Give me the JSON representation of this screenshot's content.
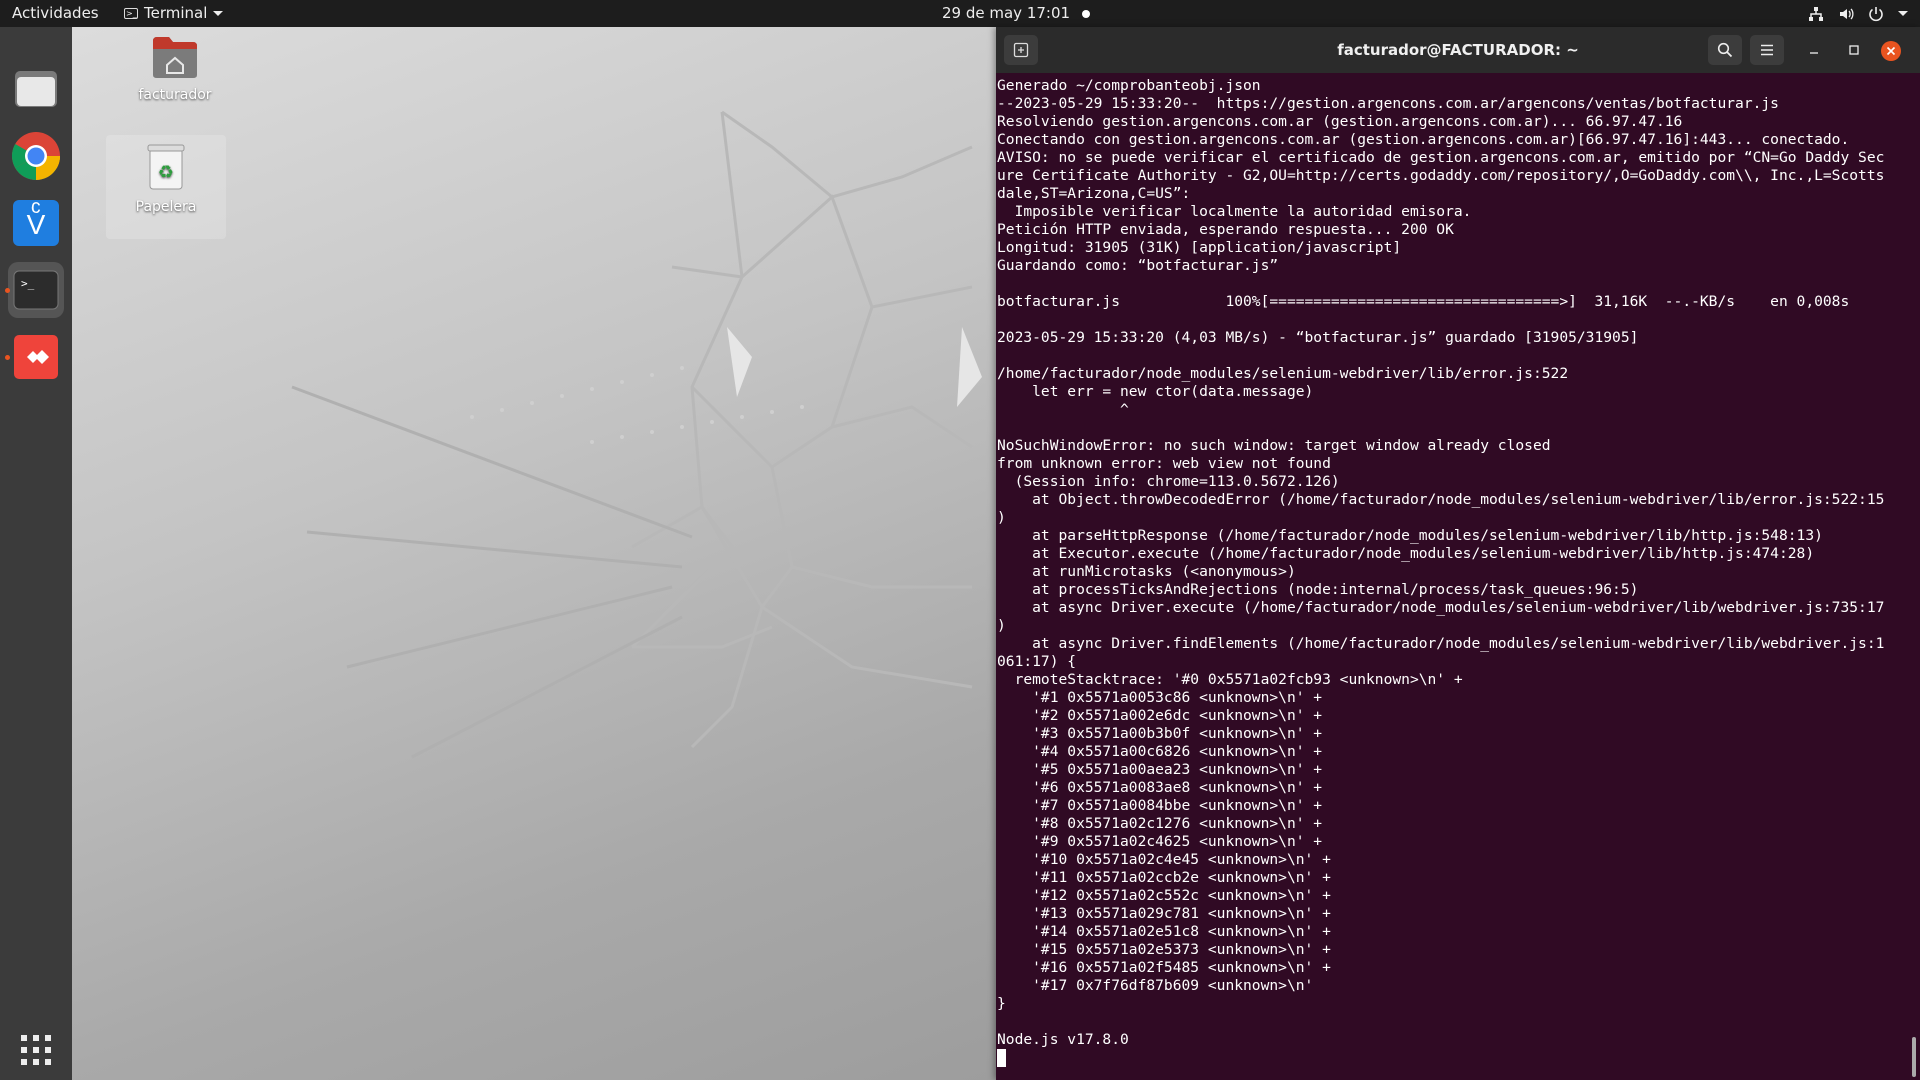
{
  "topbar": {
    "activities": "Actividades",
    "app_name": "Terminal",
    "clock": "29 de may  17:01"
  },
  "dock": {
    "apps": [
      "files",
      "chrome",
      "vscode",
      "terminal",
      "anydesk"
    ]
  },
  "desktop": {
    "icons": [
      {
        "label": "facturador"
      },
      {
        "label": "Papelera"
      }
    ]
  },
  "terminal": {
    "title": "facturador@FACTURADOR: ~",
    "colors": {
      "background": "#300a24",
      "accent": "#e95420"
    },
    "lines": [
      "Generado ~/comprobanteobj.json",
      "--2023-05-29 15:33:20--  https://gestion.argencons.com.ar/argencons/ventas/botfacturar.js",
      "Resolviendo gestion.argencons.com.ar (gestion.argencons.com.ar)... 66.97.47.16",
      "Conectando con gestion.argencons.com.ar (gestion.argencons.com.ar)[66.97.47.16]:443... conectado.",
      "AVISO: no se puede verificar el certificado de gestion.argencons.com.ar, emitido por “CN=Go Daddy Sec",
      "ure Certificate Authority - G2,OU=http://certs.godaddy.com/repository/,O=GoDaddy.com\\\\, Inc.,L=Scotts",
      "dale,ST=Arizona,C=US”:",
      "  Imposible verificar localmente la autoridad emisora.",
      "Petición HTTP enviada, esperando respuesta... 200 OK",
      "Longitud: 31905 (31K) [application/javascript]",
      "Guardando como: “botfacturar.js”",
      "",
      "botfacturar.js            100%[=================================>]  31,16K  --.-KB/s    en 0,008s",
      "",
      "2023-05-29 15:33:20 (4,03 MB/s) - “botfacturar.js” guardado [31905/31905]",
      "",
      "/home/facturador/node_modules/selenium-webdriver/lib/error.js:522",
      "    let err = new ctor(data.message)",
      "              ^",
      "",
      "NoSuchWindowError: no such window: target window already closed",
      "from unknown error: web view not found",
      "  (Session info: chrome=113.0.5672.126)",
      "    at Object.throwDecodedError (/home/facturador/node_modules/selenium-webdriver/lib/error.js:522:15",
      ")",
      "    at parseHttpResponse (/home/facturador/node_modules/selenium-webdriver/lib/http.js:548:13)",
      "    at Executor.execute (/home/facturador/node_modules/selenium-webdriver/lib/http.js:474:28)",
      "    at runMicrotasks (<anonymous>)",
      "    at processTicksAndRejections (node:internal/process/task_queues:96:5)",
      "    at async Driver.execute (/home/facturador/node_modules/selenium-webdriver/lib/webdriver.js:735:17",
      ")",
      "    at async Driver.findElements (/home/facturador/node_modules/selenium-webdriver/lib/webdriver.js:1",
      "061:17) {",
      "  remoteStacktrace: '#0 0x5571a02fcb93 <unknown>\\n' +",
      "    '#1 0x5571a0053c86 <unknown>\\n' +",
      "    '#2 0x5571a002e6dc <unknown>\\n' +",
      "    '#3 0x5571a00b3b0f <unknown>\\n' +",
      "    '#4 0x5571a00c6826 <unknown>\\n' +",
      "    '#5 0x5571a00aea23 <unknown>\\n' +",
      "    '#6 0x5571a0083ae8 <unknown>\\n' +",
      "    '#7 0x5571a0084bbe <unknown>\\n' +",
      "    '#8 0x5571a02c1276 <unknown>\\n' +",
      "    '#9 0x5571a02c4625 <unknown>\\n' +",
      "    '#10 0x5571a02c4e45 <unknown>\\n' +",
      "    '#11 0x5571a02ccb2e <unknown>\\n' +",
      "    '#12 0x5571a02c552c <unknown>\\n' +",
      "    '#13 0x5571a029c781 <unknown>\\n' +",
      "    '#14 0x5571a02e51c8 <unknown>\\n' +",
      "    '#15 0x5571a02e5373 <unknown>\\n' +",
      "    '#16 0x5571a02f5485 <unknown>\\n' +",
      "    '#17 0x7f76df87b609 <unknown>\\n'",
      "}",
      "",
      "Node.js v17.8.0"
    ]
  }
}
